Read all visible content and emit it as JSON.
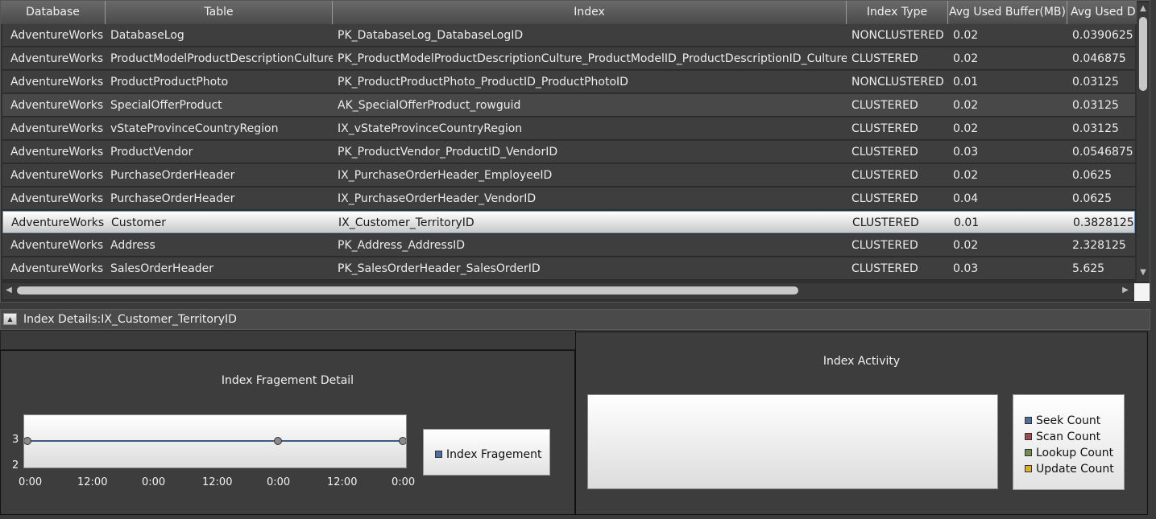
{
  "grid": {
    "columns": [
      "Database",
      "Table",
      "Index",
      "Index Type",
      "Avg Used Buffer(MB)",
      "Avg Used D"
    ],
    "rows": [
      [
        "AdventureWorks",
        "DatabaseLog",
        "PK_DatabaseLog_DatabaseLogID",
        "NONCLUSTERED",
        "0.02",
        "0.0390625"
      ],
      [
        "AdventureWorks",
        "ProductModelProductDescriptionCulture",
        "PK_ProductModelProductDescriptionCulture_ProductModelID_ProductDescriptionID_CultureID",
        "CLUSTERED",
        "0.02",
        "0.046875"
      ],
      [
        "AdventureWorks",
        "ProductProductPhoto",
        "PK_ProductProductPhoto_ProductID_ProductPhotoID",
        "NONCLUSTERED",
        "0.01",
        "0.03125"
      ],
      [
        "AdventureWorks",
        "SpecialOfferProduct",
        "AK_SpecialOfferProduct_rowguid",
        "CLUSTERED",
        "0.02",
        "0.03125"
      ],
      [
        "AdventureWorks",
        "vStateProvinceCountryRegion",
        "IX_vStateProvinceCountryRegion",
        "CLUSTERED",
        "0.02",
        "0.03125"
      ],
      [
        "AdventureWorks",
        "ProductVendor",
        "PK_ProductVendor_ProductID_VendorID",
        "CLUSTERED",
        "0.03",
        "0.0546875"
      ],
      [
        "AdventureWorks",
        "PurchaseOrderHeader",
        "IX_PurchaseOrderHeader_EmployeeID",
        "CLUSTERED",
        "0.02",
        "0.0625"
      ],
      [
        "AdventureWorks",
        "PurchaseOrderHeader",
        "IX_PurchaseOrderHeader_VendorID",
        "CLUSTERED",
        "0.04",
        "0.0625"
      ],
      [
        "AdventureWorks",
        "Customer",
        "IX_Customer_TerritoryID",
        "CLUSTERED",
        "0.01",
        "0.3828125"
      ],
      [
        "AdventureWorks",
        "Address",
        "PK_Address_AddressID",
        "CLUSTERED",
        "0.02",
        "2.328125"
      ],
      [
        "AdventureWorks",
        "SalesOrderHeader",
        "PK_SalesOrderHeader_SalesOrderID",
        "CLUSTERED",
        "0.03",
        "5.625"
      ]
    ],
    "selected_row": 8,
    "highlight_row": 3
  },
  "details": {
    "label": "Index Details:IX_Customer_TerritoryID"
  },
  "chart_data": [
    {
      "type": "line",
      "title": "Index Fragement Detail",
      "x": [
        "0:00",
        "12:00",
        "0:00",
        "12:00",
        "0:00",
        "12:00",
        "0:00"
      ],
      "series": [
        {
          "name": "Index Fragement",
          "points": [
            {
              "x": "0:00",
              "y": 3
            },
            {
              "x": "0:00",
              "y": 3
            },
            {
              "x": "0:00",
              "y": 3
            }
          ]
        }
      ],
      "ytick_labels": [
        "3",
        "2"
      ],
      "ylim": [
        2,
        3
      ],
      "legend": "right",
      "color": "#3d5a80"
    },
    {
      "type": "bar",
      "title": "Index Activity",
      "series": [
        {
          "name": "Seek Count",
          "values": [],
          "color": "#4a6fa5"
        },
        {
          "name": "Scan Count",
          "values": [],
          "color": "#a54a4a"
        },
        {
          "name": "Lookup Count",
          "values": [],
          "color": "#6f8f4a"
        },
        {
          "name": "Update Count",
          "values": [],
          "color": "#e0b020"
        }
      ],
      "legend": "right"
    }
  ],
  "icons": {
    "collapse": "collapse-up-icon",
    "scroll_up": "scroll-up-arrow-icon",
    "scroll_down": "scroll-down-arrow-icon",
    "scroll_left": "scroll-left-arrow-icon",
    "scroll_right": "scroll-right-arrow-icon"
  }
}
